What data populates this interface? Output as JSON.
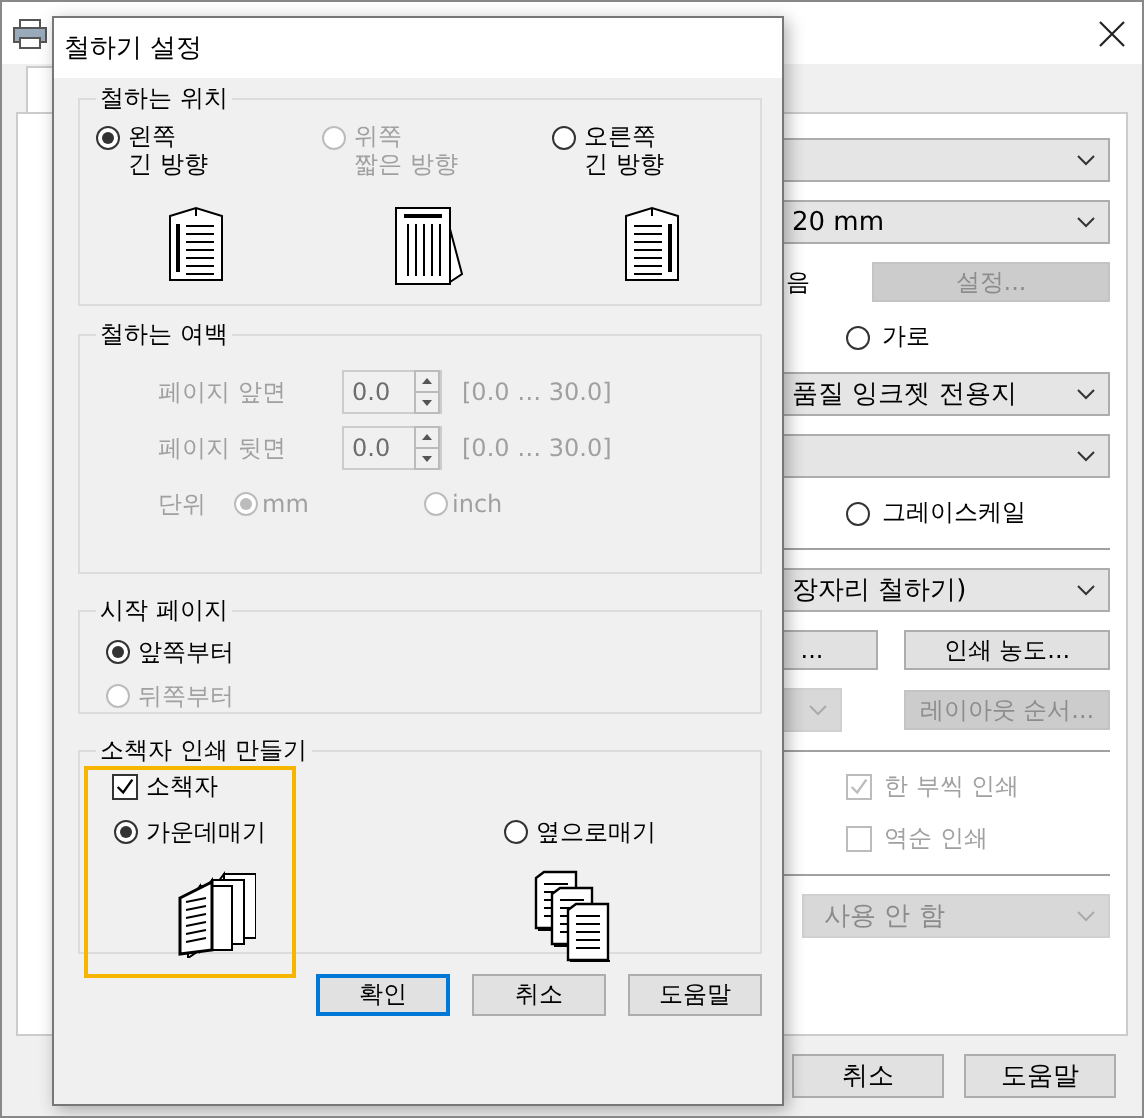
{
  "main_window": {
    "controls": [
      {
        "kind": "dropdown",
        "disabled": false
      },
      {
        "kind": "dropdown",
        "value": "20 mm",
        "disabled": false
      },
      {
        "kind": "label_button",
        "label": "음",
        "button": "설정...",
        "disabled": true
      },
      {
        "kind": "radio",
        "label": "가로",
        "selected": false
      },
      {
        "kind": "dropdown",
        "value": "품질 잉크젯 전용지",
        "disabled": false
      },
      {
        "kind": "dropdown",
        "disabled": false
      },
      {
        "kind": "radio",
        "label": "그레이스케일",
        "selected": false
      },
      {
        "kind": "divider"
      },
      {
        "kind": "dropdown",
        "value": "장자리 철하기)",
        "disabled": false
      },
      {
        "kind": "buttons",
        "buttons": [
          {
            "label": "...",
            "disabled": false
          },
          {
            "label": "인쇄 농도...",
            "disabled": false
          }
        ]
      },
      {
        "kind": "dropdown_button",
        "button": "레이아웃 순서...",
        "disabled": true
      },
      {
        "kind": "divider"
      },
      {
        "kind": "checkbox",
        "label": "한 부씩 인쇄",
        "checked": true,
        "disabled": true
      },
      {
        "kind": "checkbox",
        "label": "역순 인쇄",
        "checked": false,
        "disabled": true
      },
      {
        "kind": "divider"
      },
      {
        "kind": "dropdown",
        "value": "사용 안 함",
        "disabled": true
      }
    ],
    "buttons": [
      "취소",
      "도움말"
    ]
  },
  "dialog": {
    "title": "철하기 설정",
    "binding_position": {
      "title": "철하는 위치",
      "options": [
        {
          "lines": [
            "왼쪽",
            "긴 방향"
          ],
          "selected": true,
          "disabled": false,
          "kind": "left"
        },
        {
          "lines": [
            "위쪽",
            "짧은 방향"
          ],
          "selected": false,
          "disabled": true,
          "kind": "top"
        },
        {
          "lines": [
            "오른쪽",
            "긴 방향"
          ],
          "selected": false,
          "disabled": false,
          "kind": "right"
        }
      ]
    },
    "binding_margin": {
      "title": "철하는 여백",
      "disabled": true,
      "fields": [
        {
          "label": "페이지 앞면",
          "value": "0.0",
          "range": "[0.0 … 30.0]"
        },
        {
          "label": "페이지 뒷면",
          "value": "0.0",
          "range": "[0.0 … 30.0]"
        }
      ],
      "unit_label": "단위",
      "units": [
        {
          "label": "mm",
          "selected": true
        },
        {
          "label": "inch",
          "selected": false
        }
      ]
    },
    "start_page": {
      "title": "시작 페이지",
      "options": [
        {
          "label": "앞쪽부터",
          "selected": true,
          "disabled": false
        },
        {
          "label": "뒤쪽부터",
          "selected": false,
          "disabled": true
        }
      ]
    },
    "booklet": {
      "title": "소책자 인쇄 만들기",
      "highlighted": true,
      "checkbox": {
        "label": "소책자",
        "checked": true
      },
      "options": [
        {
          "label": "가운데매기",
          "selected": true,
          "kind": "saddle"
        },
        {
          "label": "옆으로매기",
          "selected": false,
          "kind": "side"
        }
      ]
    },
    "buttons": [
      {
        "label": "확인",
        "default": true
      },
      {
        "label": "취소",
        "default": false
      },
      {
        "label": "도움말",
        "default": false
      }
    ]
  }
}
